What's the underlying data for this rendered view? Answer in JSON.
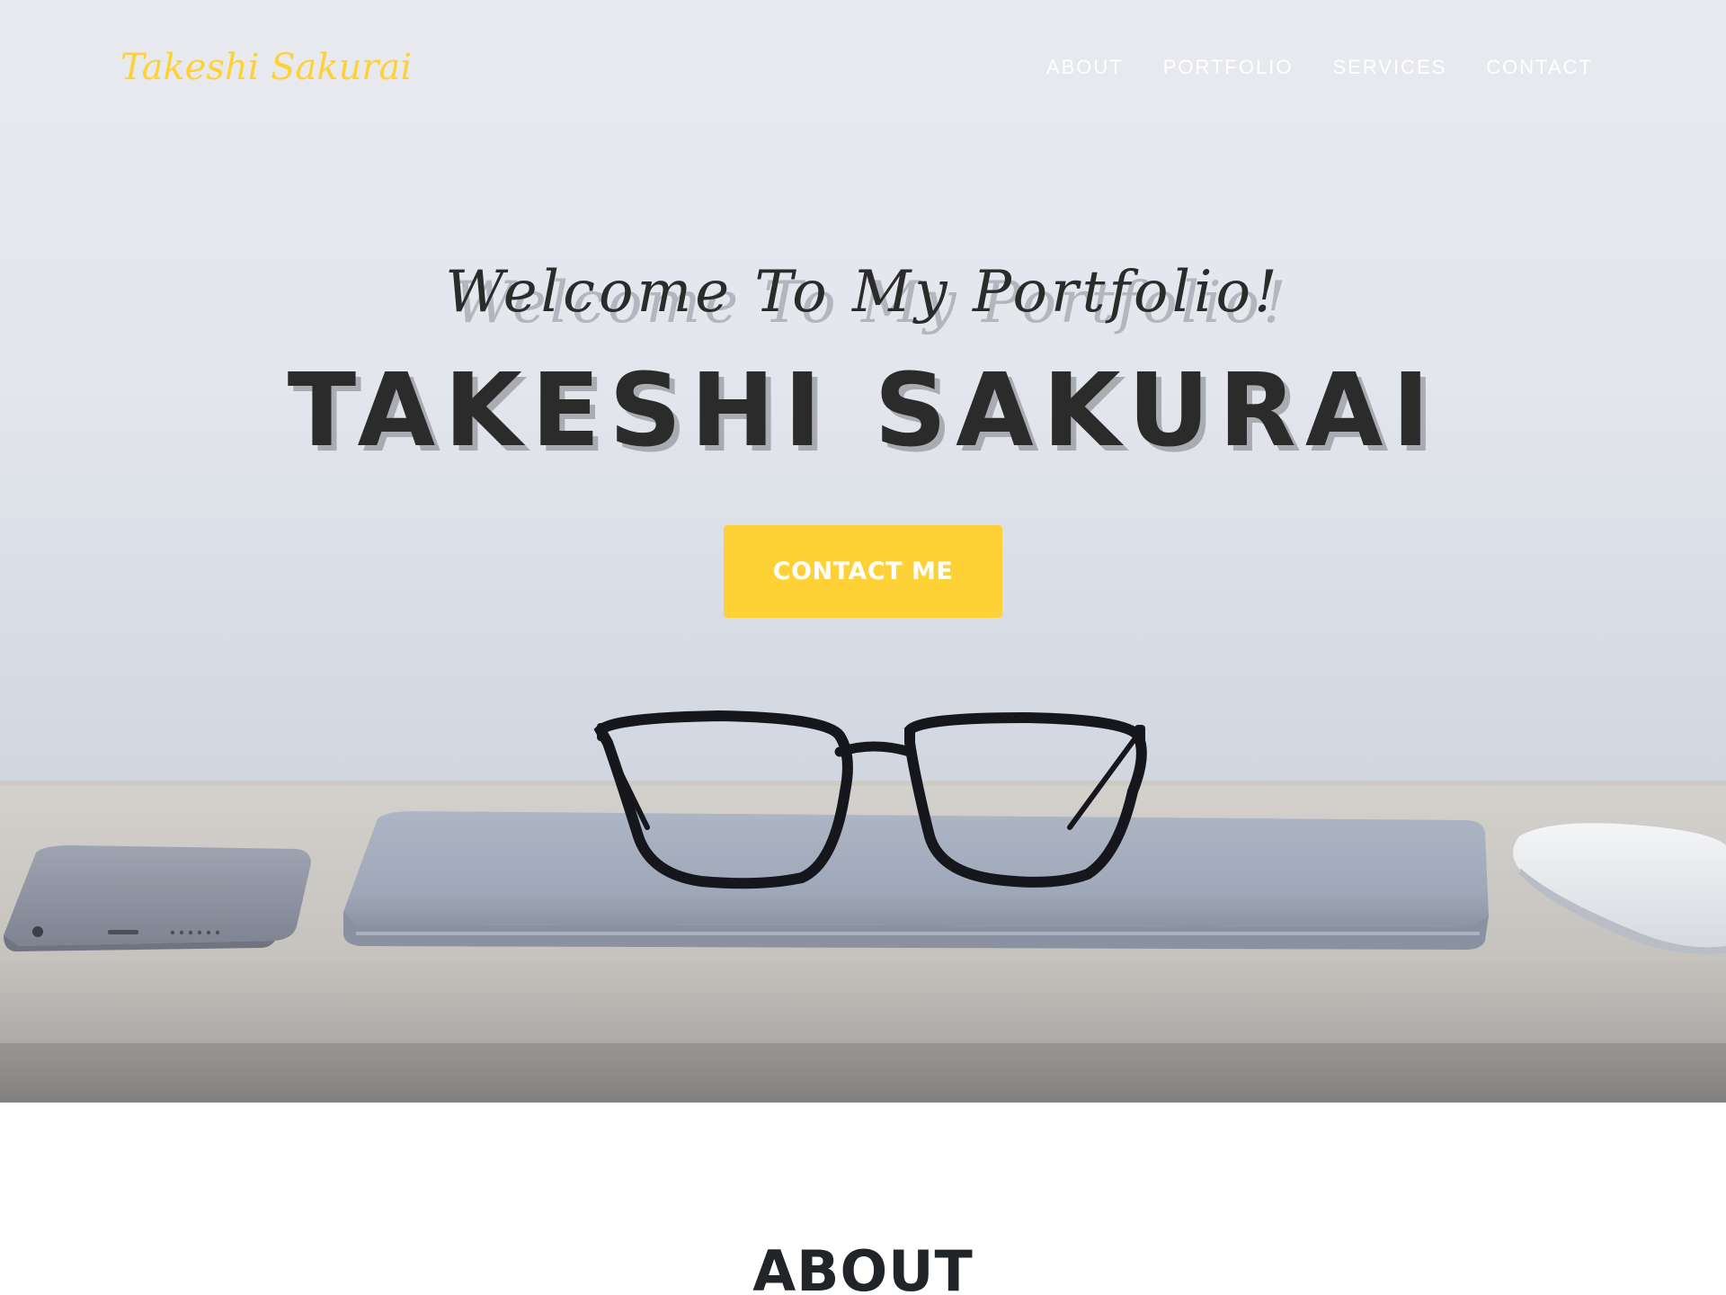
{
  "nav": {
    "brand": "Takeshi Sakurai",
    "items": [
      {
        "label": "ABOUT"
      },
      {
        "label": "PORTFOLIO"
      },
      {
        "label": "SERVICES"
      },
      {
        "label": "CONTACT"
      }
    ]
  },
  "hero": {
    "subtitle": "Welcome To My Portfolio!",
    "title": "TAKESHI SAKURAI",
    "cta_label": "CONTACT ME"
  },
  "about": {
    "heading": "ABOUT"
  },
  "colors": {
    "accent": "#fed136",
    "heading_text": "#2b2b2b",
    "nav_text": "#ffffff"
  }
}
